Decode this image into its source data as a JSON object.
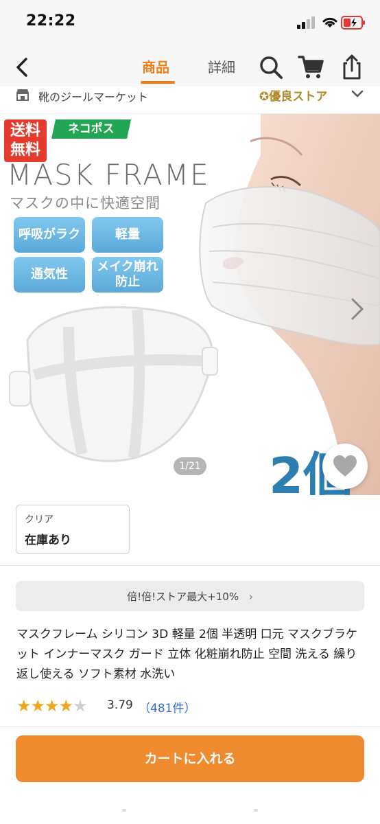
{
  "status_bar": {
    "time": "22:22"
  },
  "nav": {
    "tabs": [
      {
        "label": "商品",
        "active": true
      },
      {
        "label": "詳細",
        "active": false
      }
    ],
    "accent_color": "#ee7d1a"
  },
  "store": {
    "name": "靴のジールマーケット",
    "badge": "優良ストア"
  },
  "hero": {
    "badge_free": "送料無料",
    "badge_shipping": "ネコポス",
    "title": "MASK FRAME",
    "subtitle": "マスクの中に快適空間",
    "features": [
      "呼吸がラク",
      "軽量",
      "通気性",
      "メイク崩れ防止"
    ],
    "pager": "1/21",
    "count_text": "2個"
  },
  "variant": {
    "label": "クリア",
    "stock": "在庫あり"
  },
  "promo": {
    "text": "倍!倍!ストア最大+10%"
  },
  "product": {
    "title": "マスクフレーム シリコン 3D 軽量 2個 半透明 口元 マスクブラケット インナーマスク ガード 立体 化粧崩れ防止 空間 洗える 繰り返し使える ソフト素材 水洗い"
  },
  "rating": {
    "value": "3.79",
    "count": "（481件）",
    "stars_filled": 4,
    "stars_total": 5
  },
  "cart": {
    "label": "カートに入れる",
    "color": "#ef8a2e"
  }
}
